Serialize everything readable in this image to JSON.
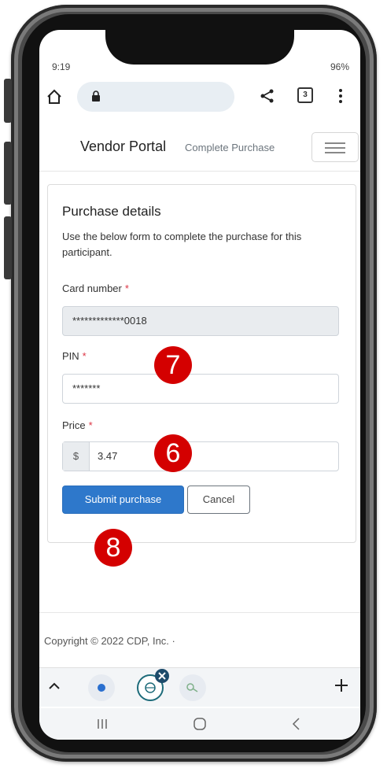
{
  "status_bar": {
    "time": "9:19",
    "right_indicators": "96%"
  },
  "browser": {
    "tab_count": "3"
  },
  "navbar": {
    "brand": "Vendor Portal",
    "link": "Complete Purchase"
  },
  "form": {
    "title": "Purchase details",
    "description": "Use the below form to complete the purchase for this participant.",
    "card_number_label": "Card number",
    "card_number_value": "*************0018",
    "pin_label": "PIN",
    "pin_value": "*******",
    "price_label": "Price",
    "price_prefix": "$",
    "price_value": "3.47",
    "required_mark": "*",
    "submit_label": "Submit purchase",
    "cancel_label": "Cancel"
  },
  "annotations": {
    "pin_step": "7",
    "price_step": "6",
    "submit_step": "8"
  },
  "footer": {
    "copyright": "Copyright © 2022 CDP, Inc. ·"
  },
  "colors": {
    "primary_button": "#2e78cb",
    "required": "#dc3545",
    "annotation_badge": "#d40000"
  }
}
